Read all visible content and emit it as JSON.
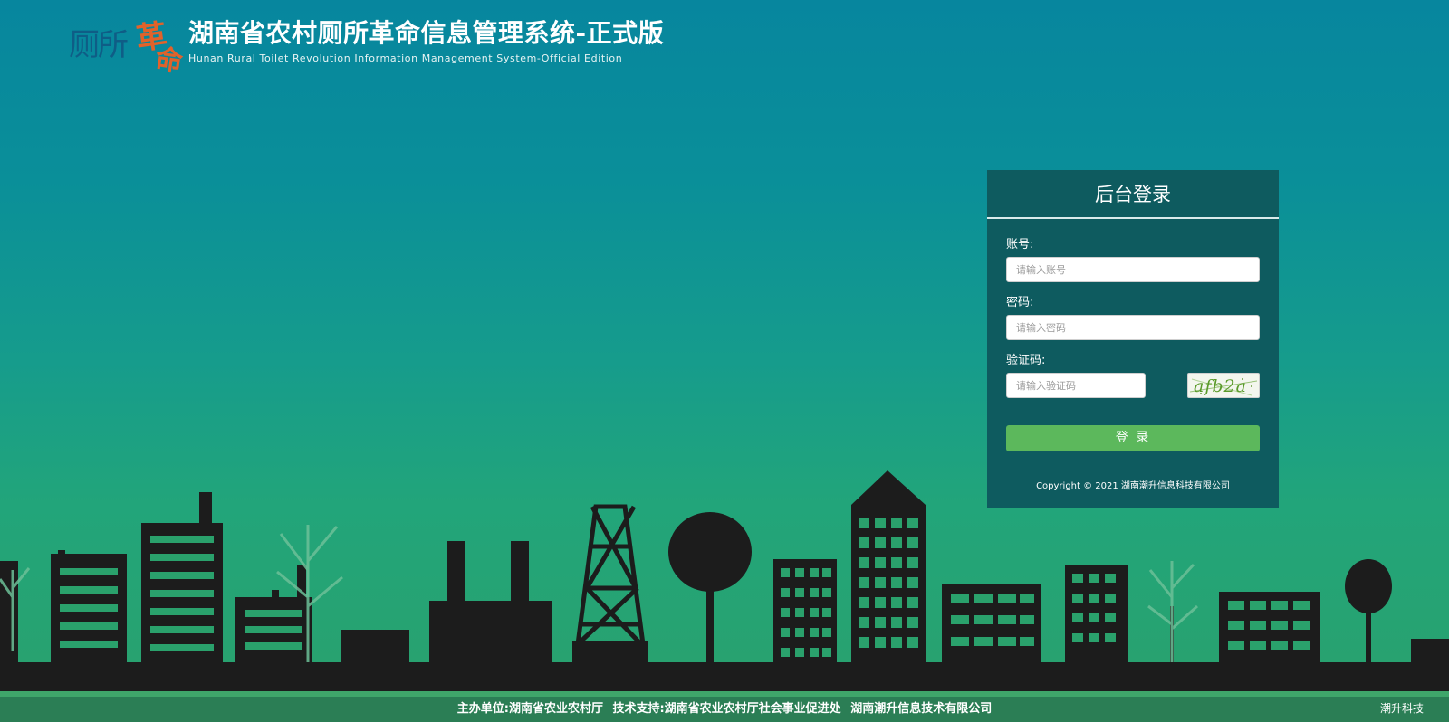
{
  "header": {
    "logo_text_a": "厕所",
    "logo_text_b": "革",
    "logo_text_c": "命",
    "title_cn": "湖南省农村厕所革命信息管理系统-正式版",
    "title_en": "Hunan Rural Toilet Revolution Information Management System-Official Edition"
  },
  "login": {
    "title": "后台登录",
    "account_label": "账号:",
    "account_placeholder": "请输入账号",
    "account_value": "",
    "password_label": "密码:",
    "password_placeholder": "请输入密码",
    "password_value": "",
    "captcha_label": "验证码:",
    "captcha_placeholder": "请输入验证码",
    "captcha_value": "",
    "captcha_image_text": "afb2a",
    "submit_label": "登 录",
    "copyright": "Copyright © 2021 湖南潮升信息科技有限公司"
  },
  "footer": {
    "host": "主办单位:湖南省农业农村厅",
    "support": "技术支持:湖南省农业农村厅社会事业促进处",
    "company": "湖南潮升信息技术有限公司",
    "corner_brand": "潮升科技"
  },
  "colors": {
    "bg_top": "#07869e",
    "bg_bottom": "#2aa16c",
    "panel": "#0e5b5f",
    "button": "#5cb85c",
    "logo_blue": "#0f5d86",
    "logo_orange": "#e2622a",
    "silhouette": "#1c1c1c"
  }
}
